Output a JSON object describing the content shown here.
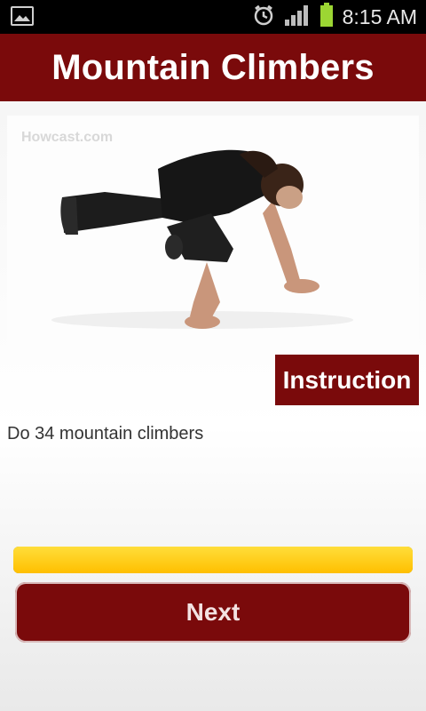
{
  "status_bar": {
    "time": "8:15 AM",
    "icons": [
      "gallery-icon",
      "alarm-icon",
      "signal-icon",
      "battery-icon"
    ]
  },
  "header": {
    "title": "Mountain Climbers"
  },
  "video": {
    "watermark": "Howcast.com"
  },
  "instruction": {
    "tab_label": "Instruction",
    "text": "Do 34 mountain climbers"
  },
  "progress": {
    "fraction": 1.0
  },
  "actions": {
    "next_label": "Next"
  },
  "colors": {
    "brand": "#7a0a0b",
    "progress": "#ffcc00"
  }
}
